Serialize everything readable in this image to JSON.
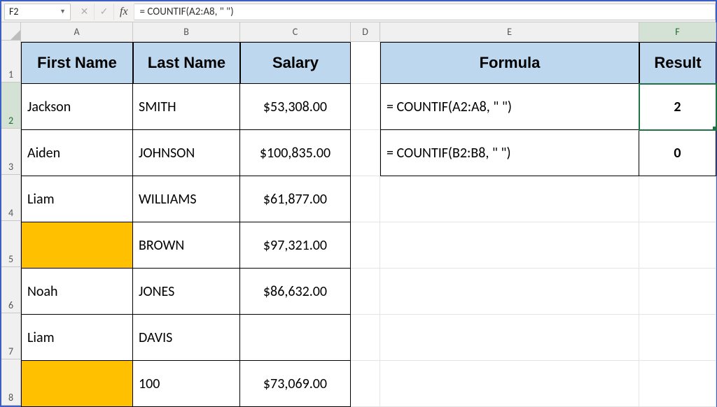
{
  "name_box": "F2",
  "formula_bar": "= COUNTIF(A2:A8, \" \")",
  "columns": [
    "A",
    "B",
    "C",
    "D",
    "E",
    "F"
  ],
  "rows": [
    "1",
    "2",
    "3",
    "4",
    "5",
    "6",
    "7",
    "8"
  ],
  "active_col_index": 5,
  "active_row_index": 1,
  "header_row": {
    "first": "First Name",
    "last": "Last Name",
    "salary": "Salary",
    "formula": "Formula",
    "result": "Result"
  },
  "data_rows": [
    {
      "first": "Jackson",
      "last": "SMITH",
      "salary": "$53,308.00",
      "highlight": false
    },
    {
      "first": "Aiden",
      "last": "JOHNSON",
      "salary": "$100,835.00",
      "highlight": false
    },
    {
      "first": "Liam",
      "last": "WILLIAMS",
      "salary": "$61,877.00",
      "highlight": false
    },
    {
      "first": "",
      "last": "BROWN",
      "salary": "$97,321.00",
      "highlight": true
    },
    {
      "first": "Noah",
      "last": "JONES",
      "salary": "$86,632.00",
      "highlight": false
    },
    {
      "first": "Liam",
      "last": "DAVIS",
      "salary": "",
      "highlight": false
    },
    {
      "first": "",
      "last": "100",
      "salary": "$73,069.00",
      "highlight": true
    }
  ],
  "side_rows": [
    {
      "formula": "= COUNTIF(A2:A8, \" \")",
      "result": "2",
      "active": true
    },
    {
      "formula": "= COUNTIF(B2:B8, \" \")",
      "result": "0",
      "active": false
    }
  ],
  "chart_data": {
    "type": "table",
    "title": "",
    "columns": [
      "First Name",
      "Last Name",
      "Salary"
    ],
    "rows": [
      [
        "Jackson",
        "SMITH",
        53308.0
      ],
      [
        "Aiden",
        "JOHNSON",
        100835.0
      ],
      [
        "Liam",
        "WILLIAMS",
        61877.0
      ],
      [
        "",
        "BROWN",
        97321.0
      ],
      [
        "Noah",
        "JONES",
        86632.0
      ],
      [
        "Liam",
        "DAVIS",
        null
      ],
      [
        "",
        100,
        73069.0
      ]
    ],
    "side_table": {
      "columns": [
        "Formula",
        "Result"
      ],
      "rows": [
        [
          "= COUNTIF(A2:A8, \" \")",
          2
        ],
        [
          "= COUNTIF(B2:B8, \" \")",
          0
        ]
      ]
    }
  }
}
